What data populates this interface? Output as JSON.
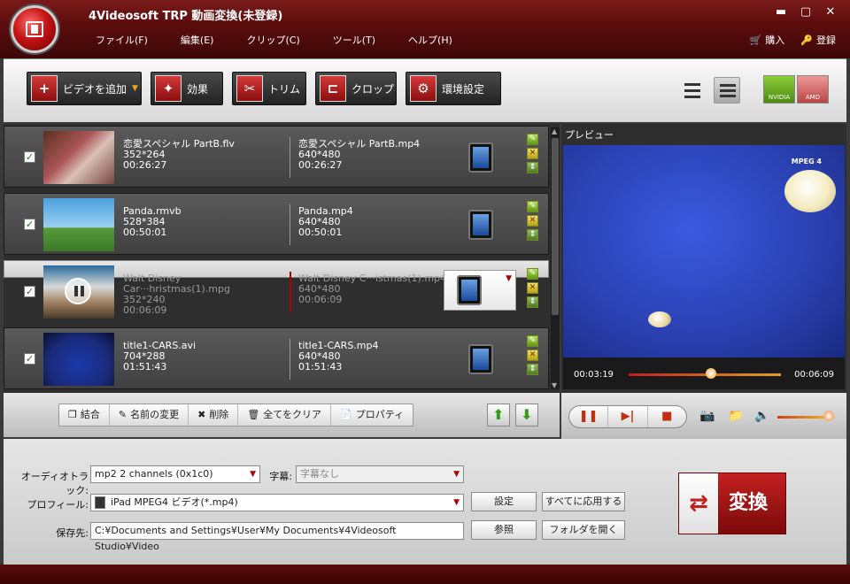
{
  "app": {
    "title": "4Videosoft TRP 動画変換(未登録)",
    "window_buttons": [
      "✕",
      "▢",
      "✕"
    ]
  },
  "menu": [
    "ファイル(F)",
    "編集(E)",
    "クリップ(C)",
    "ツール(T)",
    "ヘルプ(H)"
  ],
  "menu_right": {
    "buy": "購入",
    "register": "登録"
  },
  "toolbar": {
    "add_video": "ビデオを追加",
    "effect": "効果",
    "trim": "トリム",
    "crop": "クロップ",
    "preferences": "環境設定",
    "gpu_nvidia": "NVIDIA",
    "gpu_amd": "AMD"
  },
  "files": [
    {
      "src_name": "恋愛スペシャル PartB.flv",
      "src_res": "352*264",
      "src_dur": "00:26:27",
      "dst_name": "恋愛スペシャル PartB.mp4",
      "dst_res": "640*480",
      "dst_dur": "00:26:27"
    },
    {
      "src_name": "Panda.rmvb",
      "src_res": "528*384",
      "src_dur": "00:50:01",
      "dst_name": "Panda.mp4",
      "dst_res": "640*480",
      "dst_dur": "00:50:01"
    },
    {
      "src_name": "Walt Disney Car···hristmas(1).mpg",
      "src_res": "352*240",
      "src_dur": "00:06:09",
      "dst_name": "Walt Disney C···istmas(1).mp4",
      "dst_res": "640*480",
      "dst_dur": "00:06:09"
    },
    {
      "src_name": "title1-CARS.avi",
      "src_res": "704*288",
      "src_dur": "01:51:43",
      "dst_name": "title1-CARS.mp4",
      "dst_res": "640*480",
      "dst_dur": "01:51:43"
    }
  ],
  "listbar": {
    "merge": "結合",
    "rename": "名前の変更",
    "delete": "削除",
    "clear_all": "全てをクリア",
    "properties": "プロパティ"
  },
  "preview": {
    "title": "プレビュー",
    "current_time": "00:03:19",
    "total_time": "00:06:09",
    "progress": 0.54,
    "volume": 0.9,
    "overlay_text": "MPEG 4"
  },
  "settings": {
    "audio_track_label": "オーディオトラック:",
    "audio_track_value": "mp2 2 channels (0x1c0)",
    "subtitle_label": "字幕:",
    "subtitle_value": "字幕なし",
    "profile_label": "プロフィール:",
    "profile_value": "iPad MPEG4 ビデオ(*.mp4)",
    "save_label": "保存先:",
    "save_value": "C:¥Documents and Settings¥User¥My Documents¥4Videosoft Studio¥Video",
    "settings_btn": "設定",
    "apply_all_btn": "すべてに応用する",
    "browse_btn": "参照",
    "open_folder_btn": "フォルダを開く",
    "convert_btn": "変換"
  },
  "colors": {
    "accent": "#c42020",
    "titlebar": "#5a0c0c"
  }
}
